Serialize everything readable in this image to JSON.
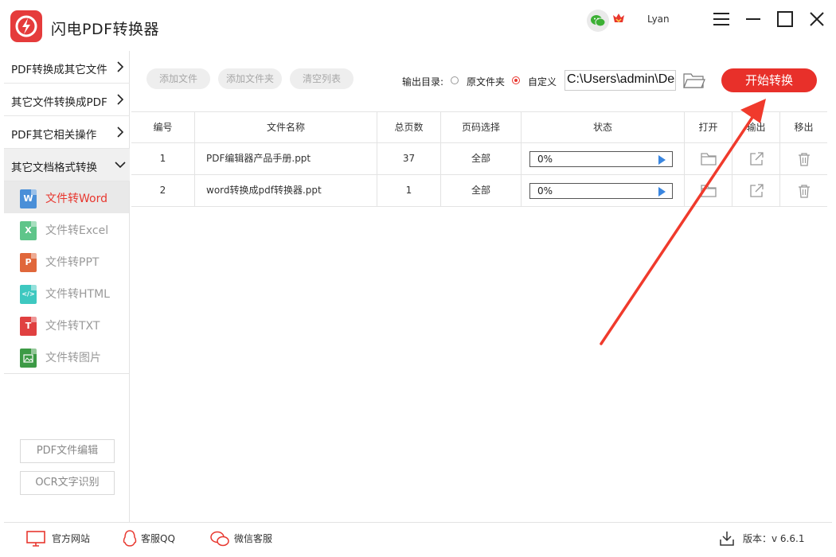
{
  "app": {
    "title": "闪电PDF转换器",
    "username": "Lyan",
    "accent": "#e8302a"
  },
  "sidebar": {
    "categories": [
      {
        "label": "PDF转换成其它文件",
        "icon": "chevron-right-icon"
      },
      {
        "label": "其它文件转换成PDF",
        "icon": "chevron-right-icon"
      },
      {
        "label": "PDF其它相关操作",
        "icon": "chevron-right-icon"
      },
      {
        "label": "其它文档格式转换",
        "icon": "chevron-down-icon"
      }
    ],
    "items": [
      {
        "label": "文件转Word",
        "badge": "W",
        "color": "#4a8fd8",
        "icon": "word-file-icon",
        "active": true
      },
      {
        "label": "文件转Excel",
        "badge": "X",
        "color": "#5fc58a",
        "icon": "excel-file-icon"
      },
      {
        "label": "文件转PPT",
        "badge": "P",
        "color": "#e0673b",
        "icon": "ppt-file-icon"
      },
      {
        "label": "文件转HTML",
        "badge": "</>",
        "color": "#3ec8c0",
        "icon": "html-file-icon"
      },
      {
        "label": "文件转TXT",
        "badge": "T",
        "color": "#e04040",
        "icon": "txt-file-icon"
      },
      {
        "label": "文件转图片",
        "badge": "",
        "color": "#3c9a45",
        "icon": "image-file-icon"
      }
    ],
    "bottom_buttons": [
      "PDF文件编辑",
      "OCR文字识别"
    ]
  },
  "toolbar": {
    "add_file": "添加文件",
    "add_folder": "添加文件夹",
    "clear_list": "清空列表",
    "output_label": "输出目录:",
    "option_original": "原文件夹",
    "option_custom": "自定义",
    "selected_option": "自定义",
    "path_value": "C:\\Users\\admin\\Desktop",
    "start": "开始转换"
  },
  "table": {
    "headers": [
      "编号",
      "文件名称",
      "总页数",
      "页码选择",
      "状态",
      "打开",
      "输出",
      "移出"
    ],
    "rows": [
      {
        "index": "1",
        "name": "PDF编辑器产品手册.ppt",
        "pages": "37",
        "range": "全部",
        "progress": "0%"
      },
      {
        "index": "2",
        "name": "word转换成pdf转换器.ppt",
        "pages": "1",
        "range": "全部",
        "progress": "0%"
      }
    ]
  },
  "footer": {
    "website": "官方网站",
    "qq": "客服QQ",
    "wechat": "微信客服",
    "version": "版本：v 6.6.1"
  }
}
